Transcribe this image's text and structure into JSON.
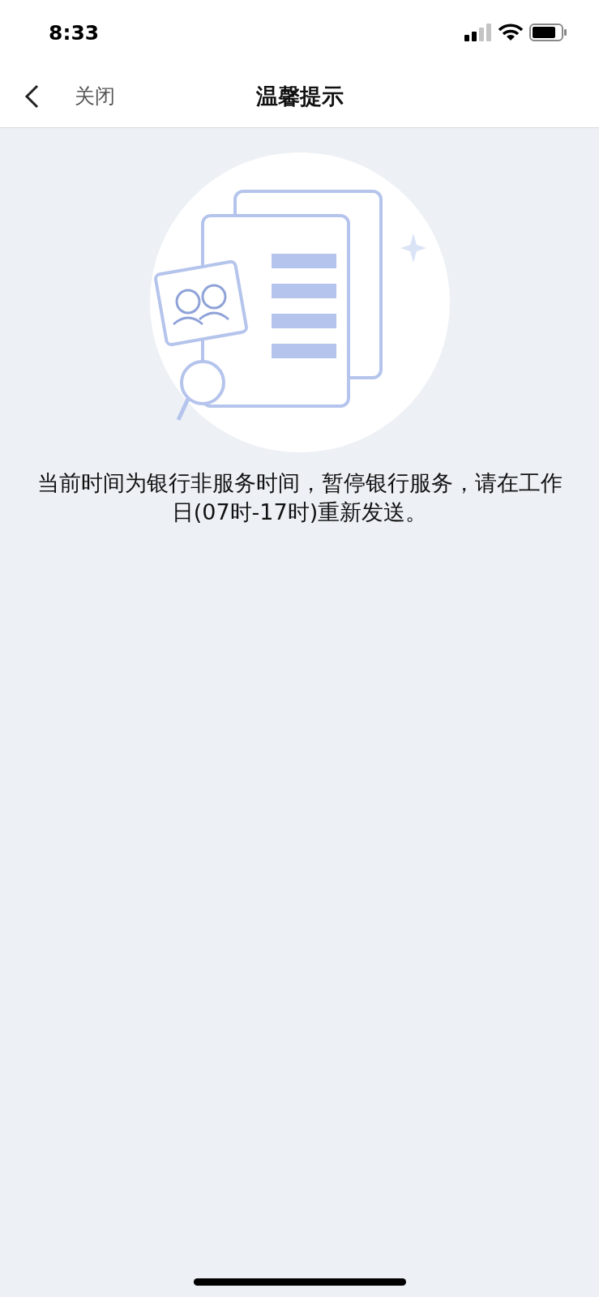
{
  "status_bar": {
    "time": "8:33"
  },
  "nav_bar": {
    "close_label": "关闭",
    "title": "温馨提示"
  },
  "message": "当前时间为银行非服务时间，暂停银行服务，请在工作日(07时-17时)重新发送。"
}
